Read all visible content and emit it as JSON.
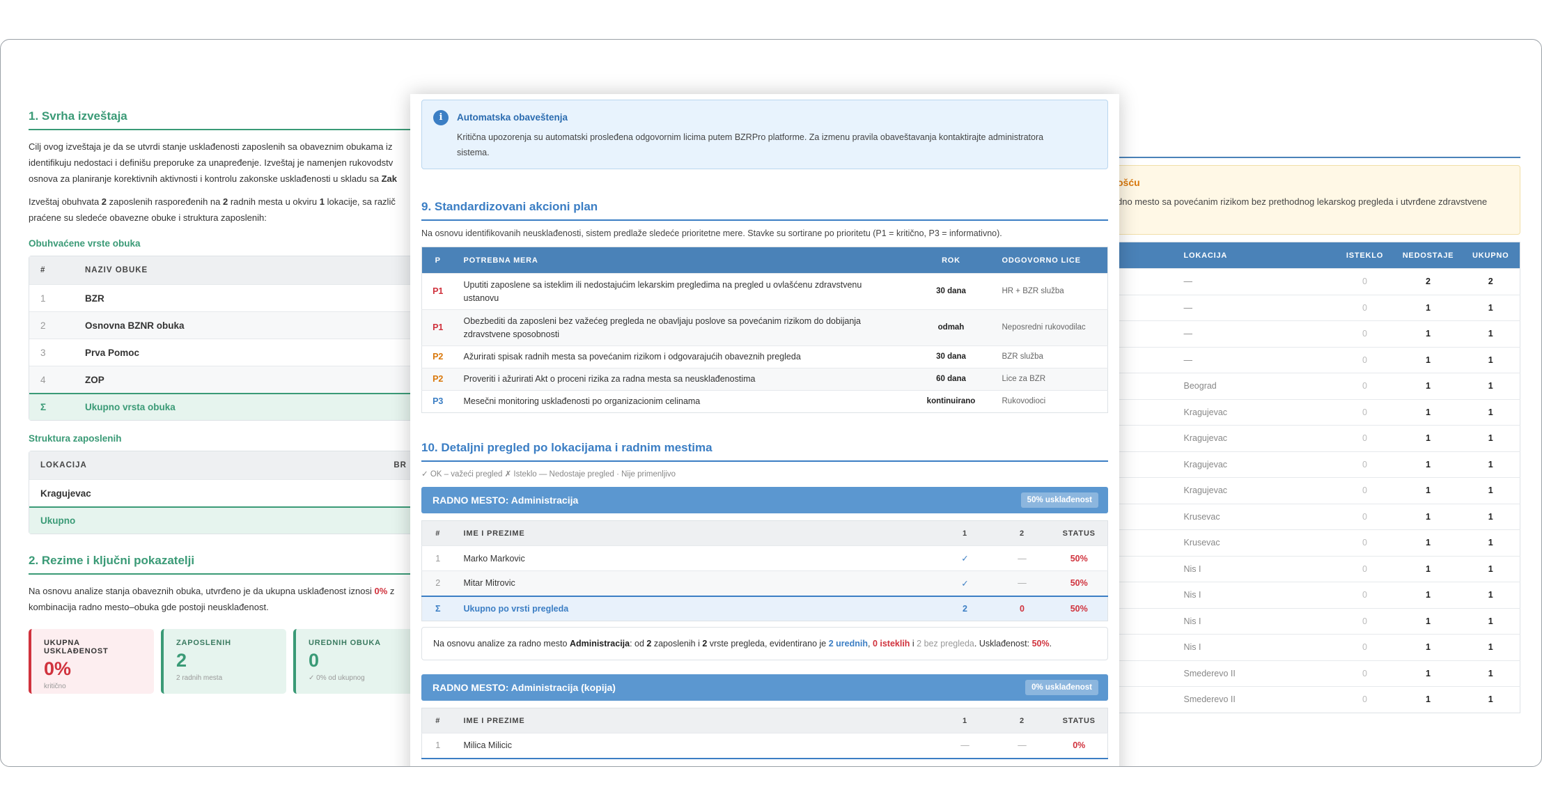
{
  "left": {
    "section1_title": "1. Svrha izveštaja",
    "p1": [
      "Cilj ovog izveštaja je da se utvrdi stanje usklađenosti zaposlenih sa obaveznim obukama iz",
      "identifikuju nedostaci i definišu preporuke za unapređenje. Izveštaj je namenjen rukovodstv",
      "osnova za planiranje korektivnih aktivnosti i kontrolu zakonske usklađenosti u skladu sa"
    ],
    "p1_bold_tail": "Zak",
    "p2a": "Izveštaj obuhvata ",
    "p2_emp": "2",
    "p2b": " zaposlenih raspoređenih na ",
    "p2_places": "2",
    "p2c": " radnih mesta u okviru ",
    "p2_loc": "1",
    "p2d": " lokacije, sa različ",
    "p2_line2": "praćene su sledeće obavezne obuke i struktura zaposlenih:",
    "trainings_title": "Obuhvaćene vrste obuka",
    "trainings_cols": [
      "#",
      "NAZIV OBUKE"
    ],
    "trainings": [
      {
        "n": "1",
        "name": "BZR"
      },
      {
        "n": "2",
        "name": "Osnovna BZNR obuka"
      },
      {
        "n": "3",
        "name": "Prva Pomoc"
      },
      {
        "n": "4",
        "name": "ZOP"
      }
    ],
    "trainings_total_sym": "Σ",
    "trainings_total": "Ukupno vrsta obuka",
    "emp_title": "Struktura zaposlenih",
    "emp_cols": [
      "LOKACIJA",
      "BR"
    ],
    "emp_row": "Kragujevac",
    "emp_total": "Ukupno",
    "section2_title": "2. Rezime i ključni pokazatelji",
    "p3a": "Na osnovu analize stanja obaveznih obuka, utvrđeno je da ukupna usklađenost iznosi ",
    "p3_pct": "0%",
    "p3b": " z",
    "p3_line2": "kombinacija radno mesto–obuka gde postoji neusklađenost.",
    "kpis": [
      {
        "label": "UKUPNA USKLAĐENOST",
        "value": "0%",
        "sub": "kritično"
      },
      {
        "label": "ZAPOSLENIH",
        "value": "2",
        "sub": "2 radnih mesta"
      },
      {
        "label": "UREDNIH OBUKA",
        "value": "0",
        "sub": "✓ 0% od ukupnog"
      }
    ]
  },
  "middle": {
    "info_icon": "i",
    "info_title": "Automatska obaveštenja",
    "info_body_1": "Kritična upozorenja su automatski prosleđena odgovornim licima putem BZRPro platforme. Za izmenu pravila obaveštavanja kontaktirajte administratora",
    "info_body_2": "sistema.",
    "section9_title": "9. Standardizovani akcioni plan",
    "section9_text": "Na osnovu identifikovanih neusklađenosti, sistem predlaže sledeće prioritetne mere. Stavke su sortirane po prioritetu (P1 = kritično, P3 = informativno).",
    "plan_cols": [
      "P",
      "POTREBNA MERA",
      "ROK",
      "ODGOVORNO LICE"
    ],
    "plan": [
      {
        "p": "P1",
        "m1": "Uputiti zaposlene sa isteklim ili nedostajućim lekarskim pregledima na pregled u ovlašćenu zdravstvenu",
        "m2": "ustanovu",
        "rok": "30 dana",
        "od": "HR + BZR služba"
      },
      {
        "p": "P1",
        "m1": "Obezbediti da zaposleni bez važećeg pregleda ne obavljaju poslove sa povećanim rizikom do dobijanja",
        "m2": "zdravstvene sposobnosti",
        "rok": "odmah",
        "od": "Neposredni rukovodilac"
      },
      {
        "p": "P2",
        "m1": "Ažurirati spisak radnih mesta sa povećanim rizikom i odgovarajućih obaveznih pregleda",
        "m2": "",
        "rok": "30 dana",
        "od": "BZR služba"
      },
      {
        "p": "P2",
        "m1": "Proveriti i ažurirati Akt o proceni rizika za radna mesta sa neusklađenostima",
        "m2": "",
        "rok": "60 dana",
        "od": "Lice za BZR"
      },
      {
        "p": "P3",
        "m1": "Mesečni monitoring usklađenosti po organizacionim celinama",
        "m2": "",
        "rok": "kontinuirano",
        "od": "Rukovodioci"
      }
    ],
    "section10_title": "10. Detaljni pregled po lokacijama i radnim mestima",
    "legend": "✓ OK – važeći pregled  ✗ Isteklo — Nedostaje pregled · Nije primenljivo",
    "wp1_title": "RADNO MESTO: Administracija",
    "wp1_badge": "50% usklađenost",
    "emp_cols": [
      "#",
      "IME I PREZIME",
      "1",
      "2",
      "STATUS"
    ],
    "wp1_rows": [
      {
        "n": "1",
        "name": "Marko Markovic",
        "c1": "✓",
        "c2": "—",
        "st": "50%"
      },
      {
        "n": "2",
        "name": "Mitar Mitrovic",
        "c1": "✓",
        "c2": "—",
        "st": "50%"
      }
    ],
    "wp1_sum": {
      "sym": "Σ",
      "label": "Ukupno po vrsti pregleda",
      "c1": "2",
      "c2": "0",
      "st": "50%"
    },
    "note": {
      "a": "Na osnovu analize za radno mesto ",
      "place": "Administracija",
      "b": ": od ",
      "emp": "2",
      "c": " zaposlenih i ",
      "types": "2",
      "d": " vrste pregleda, evidentirano je ",
      "ok": "2 urednih",
      "e": ", ",
      "exp": "0 isteklih",
      "f": " i ",
      "none": "2 bez pregleda",
      "g": ". Usklađenost: ",
      "pct": "50%",
      "h": "."
    },
    "wp2_title": "RADNO MESTO: Administracija (kopija)",
    "wp2_badge": "0% usklađenost",
    "wp2_rows": [
      {
        "n": "1",
        "name": "Milica Milicic",
        "c1": "—",
        "c2": "—",
        "st": "0%"
      }
    ]
  },
  "right": {
    "warn_title": "ošću",
    "warn_body": "dno mesto sa povećanim rizikom bez prethodnog lekarskog pregleda i utvrđene zdravstvene",
    "cols": [
      "LOKACIJA",
      "ISTEKLO",
      "NEDOSTAJE",
      "UKUPNO"
    ],
    "rows": [
      {
        "loc": "—",
        "ist": "0",
        "ned": "2",
        "uk": "2"
      },
      {
        "loc": "—",
        "ist": "0",
        "ned": "1",
        "uk": "1"
      },
      {
        "loc": "—",
        "ist": "0",
        "ned": "1",
        "uk": "1"
      },
      {
        "loc": "—",
        "ist": "0",
        "ned": "1",
        "uk": "1"
      },
      {
        "loc": "Beograd",
        "ist": "0",
        "ned": "1",
        "uk": "1"
      },
      {
        "loc": "Kragujevac",
        "ist": "0",
        "ned": "1",
        "uk": "1"
      },
      {
        "loc": "Kragujevac",
        "ist": "0",
        "ned": "1",
        "uk": "1"
      },
      {
        "loc": "Kragujevac",
        "ist": "0",
        "ned": "1",
        "uk": "1"
      },
      {
        "loc": "Kragujevac",
        "ist": "0",
        "ned": "1",
        "uk": "1"
      },
      {
        "loc": "Krusevac",
        "ist": "0",
        "ned": "1",
        "uk": "1"
      },
      {
        "loc": "Krusevac",
        "ist": "0",
        "ned": "1",
        "uk": "1"
      },
      {
        "loc": "Nis I",
        "ist": "0",
        "ned": "1",
        "uk": "1"
      },
      {
        "loc": "Nis I",
        "ist": "0",
        "ned": "1",
        "uk": "1"
      },
      {
        "loc": "Nis I",
        "ist": "0",
        "ned": "1",
        "uk": "1"
      },
      {
        "loc": "Nis I",
        "ist": "0",
        "ned": "1",
        "uk": "1"
      },
      {
        "loc": "Smederevo II",
        "ist": "0",
        "ned": "1",
        "uk": "1"
      },
      {
        "loc": "Smederevo II",
        "ist": "0",
        "ned": "1",
        "uk": "1"
      }
    ]
  },
  "colors": {
    "green": "#3a9a76",
    "blue": "#4a82b8",
    "red": "#d0323d",
    "orange": "#d9780c"
  }
}
